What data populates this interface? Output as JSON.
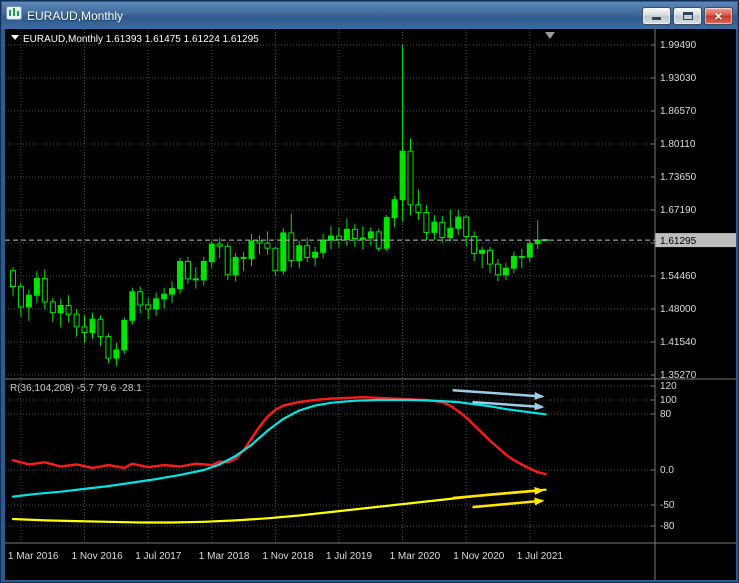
{
  "window": {
    "title": "EURAUD,Monthly",
    "close_glyph": "×",
    "icons": [
      "candlestick-chart-icon",
      "minimize-icon",
      "restore-icon",
      "close-icon"
    ]
  },
  "chart_data": [
    {
      "type": "candlestick",
      "symbol": "EURAUD",
      "timeframe": "Monthly",
      "ohlc_label": {
        "symbol_text": "EURAUD,Monthly",
        "open": "1.61393",
        "high": "1.61475",
        "low": "1.61224",
        "close": "1.61295"
      },
      "current_price": "1.61295",
      "price_axis": [
        "1.99490",
        "1.93030",
        "1.86570",
        "1.80110",
        "1.73650",
        "1.67190",
        "",
        "1.54460",
        "1.48000",
        "1.41540",
        "1.35270"
      ],
      "time_axis": [
        "1 Mar 2016",
        "1 Nov 2016",
        "1 Jul 2017",
        "1 Mar 2018",
        "1 Nov 2018",
        "1 Jul 2019",
        "1 Mar 2020",
        "1 Nov 2020",
        "1 Jul 2021"
      ],
      "first_candle_month": "Feb 2016",
      "candles": [
        [
          1.553,
          1.56,
          1.503,
          1.522
        ],
        [
          1.522,
          1.53,
          1.462,
          1.482
        ],
        [
          1.482,
          1.516,
          1.455,
          1.505
        ],
        [
          1.505,
          1.552,
          1.49,
          1.538
        ],
        [
          1.538,
          1.556,
          1.478,
          1.492
        ],
        [
          1.492,
          1.5,
          1.452,
          1.471
        ],
        [
          1.471,
          1.498,
          1.442,
          1.485
        ],
        [
          1.485,
          1.505,
          1.452,
          1.468
        ],
        [
          1.468,
          1.478,
          1.424,
          1.443
        ],
        [
          1.443,
          1.466,
          1.412,
          1.432
        ],
        [
          1.432,
          1.471,
          1.42,
          1.458
        ],
        [
          1.458,
          1.465,
          1.405,
          1.424
        ],
        [
          1.424,
          1.43,
          1.372,
          1.382
        ],
        [
          1.382,
          1.412,
          1.366,
          1.398
        ],
        [
          1.398,
          1.462,
          1.39,
          1.456
        ],
        [
          1.456,
          1.52,
          1.448,
          1.512
        ],
        [
          1.512,
          1.522,
          1.47,
          1.486
        ],
        [
          1.486,
          1.5,
          1.458,
          1.478
        ],
        [
          1.478,
          1.51,
          1.465,
          1.498
        ],
        [
          1.498,
          1.52,
          1.478,
          1.507
        ],
        [
          1.507,
          1.532,
          1.49,
          1.518
        ],
        [
          1.518,
          1.578,
          1.508,
          1.571
        ],
        [
          1.571,
          1.58,
          1.528,
          1.537
        ],
        [
          1.537,
          1.56,
          1.518,
          1.535
        ],
        [
          1.535,
          1.58,
          1.524,
          1.571
        ],
        [
          1.571,
          1.612,
          1.558,
          1.605
        ],
        [
          1.605,
          1.618,
          1.578,
          1.601
        ],
        [
          1.601,
          1.608,
          1.535,
          1.545
        ],
        [
          1.545,
          1.588,
          1.532,
          1.579
        ],
        [
          1.579,
          1.59,
          1.552,
          1.577
        ],
        [
          1.577,
          1.625,
          1.562,
          1.611
        ],
        [
          1.611,
          1.622,
          1.585,
          1.607
        ],
        [
          1.607,
          1.63,
          1.585,
          1.597
        ],
        [
          1.597,
          1.6,
          1.543,
          1.553
        ],
        [
          1.553,
          1.637,
          1.545,
          1.627
        ],
        [
          1.627,
          1.665,
          1.56,
          1.573
        ],
        [
          1.573,
          1.612,
          1.558,
          1.602
        ],
        [
          1.602,
          1.618,
          1.57,
          1.579
        ],
        [
          1.579,
          1.6,
          1.562,
          1.589
        ],
        [
          1.589,
          1.625,
          1.578,
          1.613
        ],
        [
          1.613,
          1.64,
          1.595,
          1.621
        ],
        [
          1.621,
          1.638,
          1.598,
          1.614
        ],
        [
          1.614,
          1.655,
          1.602,
          1.634
        ],
        [
          1.634,
          1.645,
          1.6,
          1.616
        ],
        [
          1.616,
          1.64,
          1.595,
          1.617
        ],
        [
          1.617,
          1.638,
          1.602,
          1.629
        ],
        [
          1.629,
          1.635,
          1.592,
          1.597
        ],
        [
          1.597,
          1.662,
          1.592,
          1.657
        ],
        [
          1.657,
          1.7,
          1.638,
          1.692
        ],
        [
          1.692,
          1.995,
          1.65,
          1.787
        ],
        [
          1.787,
          1.812,
          1.662,
          1.682
        ],
        [
          1.682,
          1.712,
          1.652,
          1.667
        ],
        [
          1.667,
          1.682,
          1.612,
          1.628
        ],
        [
          1.628,
          1.662,
          1.614,
          1.648
        ],
        [
          1.648,
          1.66,
          1.608,
          1.618
        ],
        [
          1.618,
          1.672,
          1.61,
          1.636
        ],
        [
          1.636,
          1.672,
          1.622,
          1.658
        ],
        [
          1.658,
          1.662,
          1.6,
          1.62
        ],
        [
          1.62,
          1.63,
          1.572,
          1.587
        ],
        [
          1.587,
          1.6,
          1.558,
          1.593
        ],
        [
          1.593,
          1.6,
          1.548,
          1.566
        ],
        [
          1.566,
          1.576,
          1.532,
          1.545
        ],
        [
          1.545,
          1.568,
          1.535,
          1.558
        ],
        [
          1.558,
          1.59,
          1.548,
          1.581
        ],
        [
          1.581,
          1.596,
          1.558,
          1.58
        ],
        [
          1.58,
          1.612,
          1.57,
          1.606
        ],
        [
          1.606,
          1.652,
          1.595,
          1.613
        ],
        [
          1.61393,
          1.61475,
          1.61224,
          1.61295
        ]
      ],
      "colors": {
        "background": "#000000",
        "grid": "#4B4B4B",
        "candle": "#00E400",
        "price_line": "#BEBEBE",
        "axis_text": "#DCDCDC",
        "separator": "#7A7A7A"
      }
    },
    {
      "type": "line",
      "label": "R(36,104,208) -5.7 79.6 -28.1",
      "levels": [
        {
          "label": "120",
          "value": 120
        },
        {
          "label": "100",
          "value": 100
        },
        {
          "label": "80",
          "value": 80
        },
        {
          "label": "0.0",
          "value": 0
        },
        {
          "label": "-50",
          "value": -50
        },
        {
          "label": "-80",
          "value": -80
        }
      ],
      "series": [
        {
          "name": "red",
          "color": "#FF1A1A",
          "width": 2.4,
          "current_value": -5.7,
          "points": [
            [
              0,
              14
            ],
            [
              2,
              8
            ],
            [
              4,
              11
            ],
            [
              6,
              5
            ],
            [
              8,
              8
            ],
            [
              10,
              3
            ],
            [
              12,
              7
            ],
            [
              14,
              3
            ],
            [
              15,
              9
            ],
            [
              17,
              4
            ],
            [
              19,
              7
            ],
            [
              21,
              5
            ],
            [
              23,
              9
            ],
            [
              25,
              7
            ],
            [
              26,
              12
            ],
            [
              27,
              11
            ],
            [
              28,
              16
            ],
            [
              29,
              28
            ],
            [
              30,
              45
            ],
            [
              31,
              62
            ],
            [
              32,
              76
            ],
            [
              33,
              86
            ],
            [
              34,
              92
            ],
            [
              36,
              97
            ],
            [
              38,
              100
            ],
            [
              40,
              102
            ],
            [
              42,
              103
            ],
            [
              44,
              104
            ],
            [
              46,
              103
            ],
            [
              48,
              102
            ],
            [
              50,
              101
            ],
            [
              52,
              100
            ],
            [
              54,
              97
            ],
            [
              55,
              92
            ],
            [
              56,
              84
            ],
            [
              57,
              75
            ],
            [
              58,
              64
            ],
            [
              59,
              53
            ],
            [
              60,
              42
            ],
            [
              61,
              32
            ],
            [
              62,
              22
            ],
            [
              63,
              14
            ],
            [
              64,
              8
            ],
            [
              65,
              2
            ],
            [
              66,
              -3
            ],
            [
              67,
              -5.7
            ]
          ]
        },
        {
          "name": "cyan",
          "color": "#00E5E5",
          "width": 2.2,
          "current_value": 79.6,
          "points": [
            [
              0,
              -38
            ],
            [
              3,
              -34
            ],
            [
              6,
              -31
            ],
            [
              9,
              -27
            ],
            [
              12,
              -23
            ],
            [
              15,
              -18
            ],
            [
              18,
              -13
            ],
            [
              21,
              -7
            ],
            [
              24,
              0
            ],
            [
              26,
              8
            ],
            [
              28,
              20
            ],
            [
              30,
              36
            ],
            [
              32,
              56
            ],
            [
              34,
              73
            ],
            [
              36,
              85
            ],
            [
              38,
              92
            ],
            [
              40,
              96
            ],
            [
              43,
              99
            ],
            [
              46,
              100
            ],
            [
              50,
              100
            ],
            [
              53,
              99
            ],
            [
              56,
              97
            ],
            [
              58,
              94
            ],
            [
              60,
              91
            ],
            [
              62,
              87
            ],
            [
              64,
              84
            ],
            [
              66,
              81
            ],
            [
              67,
              79.6
            ]
          ]
        },
        {
          "name": "yellow",
          "color": "#FFFF00",
          "width": 2.2,
          "current_value": -28.1,
          "points": [
            [
              0,
              -70
            ],
            [
              4,
              -72
            ],
            [
              8,
              -73
            ],
            [
              12,
              -74
            ],
            [
              16,
              -75
            ],
            [
              20,
              -75
            ],
            [
              24,
              -74
            ],
            [
              28,
              -72
            ],
            [
              32,
              -69
            ],
            [
              36,
              -65
            ],
            [
              40,
              -60
            ],
            [
              44,
              -55
            ],
            [
              48,
              -50
            ],
            [
              52,
              -45
            ],
            [
              56,
              -40
            ],
            [
              60,
              -35
            ],
            [
              63,
              -32
            ],
            [
              66,
              -29
            ],
            [
              67,
              -28.1
            ]
          ]
        }
      ],
      "arrows": [
        {
          "color": "#9CCEE8",
          "from": [
            55.3,
            114
          ],
          "to": [
            66.6,
            105
          ]
        },
        {
          "color": "#9CCEE8",
          "from": [
            57.8,
            97
          ],
          "to": [
            66.6,
            90
          ]
        },
        {
          "color": "#FFE600",
          "from": [
            55.3,
            -40
          ],
          "to": [
            66.6,
            -29
          ]
        },
        {
          "color": "#FFE600",
          "from": [
            57.8,
            -53
          ],
          "to": [
            66.6,
            -44
          ]
        }
      ]
    }
  ]
}
